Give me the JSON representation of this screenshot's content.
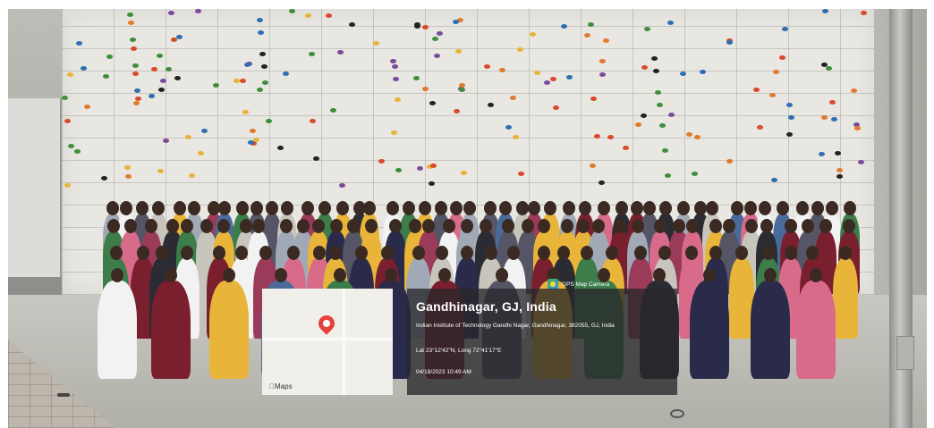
{
  "location": {
    "title": "Gandhinagar, GJ, India",
    "address": "Indian Institute of Technology Gandhi Nagar, Gandhinagar, 382055, GJ, India",
    "coordinates": "Lat 23°12'42\"N, Long 72°41'17\"E",
    "timestamp": "04/18/2023 10:49 AM"
  },
  "map": {
    "brand": "Maps",
    "pin_color": "#e5423a"
  },
  "watermark": {
    "app_name": "GPS Map Camera"
  },
  "colors": {
    "wall": "#e9e7e2",
    "overlay": "rgba(40,40,42,0.78)"
  }
}
